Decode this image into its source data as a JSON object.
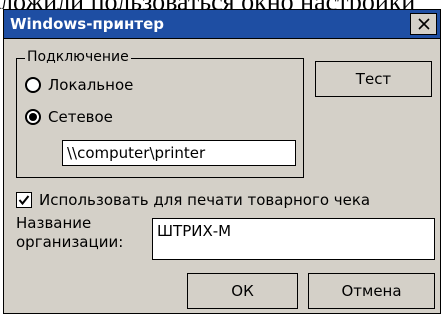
{
  "background_text": "ложили пользоваться окно настройки",
  "window": {
    "title": "Windows-принтер",
    "title_bar_color": "#1e4ea3",
    "close_icon": "close-icon"
  },
  "connection_group": {
    "legend": "Подключение",
    "options": [
      {
        "label": "Локальное",
        "checked": false
      },
      {
        "label": "Сетевое",
        "checked": true
      }
    ],
    "path_value": "\\\\computer\\printer"
  },
  "buttons": {
    "test_label": "Тест",
    "ok_label": "ОК",
    "cancel_label": "Отмена"
  },
  "receipt_checkbox": {
    "label": "Использовать для печати товарного чека",
    "checked": true
  },
  "organization": {
    "label_line1": "Название",
    "label_line2": "организации:",
    "value": "ШТРИХ-М"
  }
}
